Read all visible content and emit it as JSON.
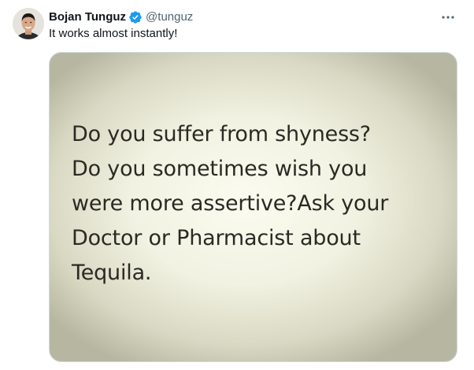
{
  "tweet": {
    "author": {
      "display_name": "Bojan Tunguz",
      "handle": "@tunguz",
      "verified": true,
      "avatar_icon": "profile-photo"
    },
    "text": "It works almost instantly!",
    "more_icon": "more-horizontal-icon",
    "media": {
      "lines": [
        "Do you suffer from shyness?",
        "Do you sometimes wish you",
        "were more assertive?Ask your",
        "Doctor or Pharmacist about",
        "Tequila."
      ]
    }
  },
  "colors": {
    "verified_badge": "#1d9bf0",
    "handle_text": "#536471",
    "primary_text": "#0f1419"
  }
}
